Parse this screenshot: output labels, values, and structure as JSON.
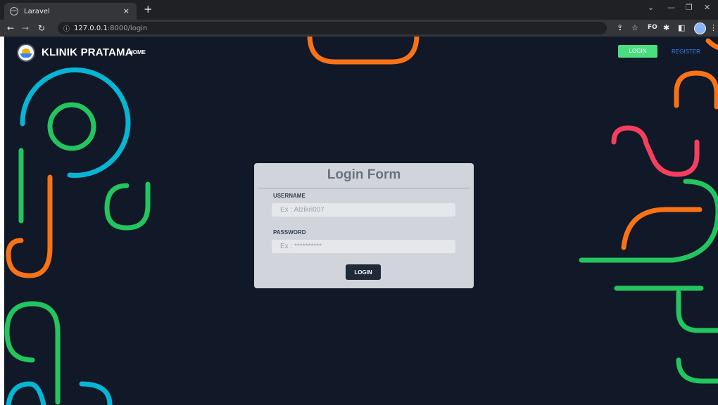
{
  "browser": {
    "tab_title": "Laravel",
    "tab_close": "×",
    "new_tab": "+",
    "url_host": "127.0.0.1",
    "url_path": ":8000/login",
    "profile_badge": "FO"
  },
  "navbar": {
    "brand": "KLINIK PRATAMA",
    "home": "HOME",
    "login": "LOGIN",
    "register": "REGISTER"
  },
  "login_form": {
    "title": "Login Form",
    "username_label": "USERNAME",
    "username_placeholder": "Ex : Alzikri007",
    "username_value": "",
    "password_label": "PASSWORD",
    "password_placeholder": "Ex : **********",
    "password_value": "",
    "submit_label": "LOGIN"
  },
  "theme": {
    "background": "#111827",
    "card": "#d1d5db",
    "accent_green": "#4ade80",
    "accent_cyan": "#06b6d4",
    "accent_orange": "#f97316",
    "accent_pink": "#f43f5e",
    "accent_teal": "#22c55e",
    "link_blue": "#3b82f6"
  }
}
